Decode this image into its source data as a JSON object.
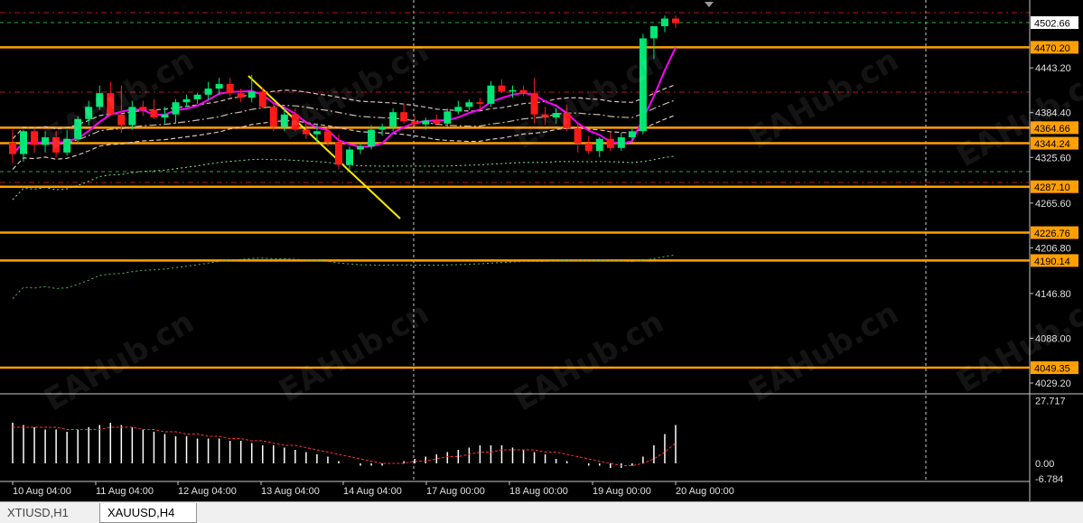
{
  "tabs": [
    {
      "label": "XTIUSD,H1",
      "active": false
    },
    {
      "label": "XAUUSD,H4",
      "active": true
    }
  ],
  "watermark_text": "EAHub.cn",
  "colors": {
    "background": "#000000",
    "bull_candle": "#00e676",
    "bear_candle": "#ff1a1a",
    "level_line": "#ffa000",
    "fast_ma": "#ff00ff",
    "trend_line": "#ffea00",
    "price_tag_bg": "#ffa000",
    "current_price_bg": "#ffffff",
    "osc_hist": "#ffffff",
    "osc_signal": "#ff3030"
  },
  "chart_data": {
    "type": "candlestick",
    "symbol": "XAUUSD",
    "timeframe": "H4",
    "x_tick_labels": [
      "10 Aug 04:00",
      "11 Aug 04:00",
      "12 Aug 04:00",
      "13 Aug 04:00",
      "14 Aug 04:00",
      "17 Aug 00:00",
      "18 Aug 00:00",
      "19 Aug 00:00",
      "20 Aug 00:00"
    ],
    "y_tick_labels": [
      "4443.20",
      "4384.40",
      "4325.60",
      "4265.60",
      "4206.80",
      "4146.80",
      "4088.00",
      "4029.20"
    ],
    "ylim": [
      4015,
      4530
    ],
    "current_price": "4502.66",
    "horizontal_levels": [
      "4470.20",
      "4364.66",
      "4344.24",
      "4287.10",
      "4226.76",
      "4190.14",
      "4049.35"
    ],
    "candles": [
      {
        "o": 4345,
        "h": 4362,
        "l": 4318,
        "c": 4330
      },
      {
        "o": 4330,
        "h": 4362,
        "l": 4320,
        "c": 4360
      },
      {
        "o": 4360,
        "h": 4363,
        "l": 4332,
        "c": 4342
      },
      {
        "o": 4342,
        "h": 4360,
        "l": 4332,
        "c": 4352
      },
      {
        "o": 4352,
        "h": 4360,
        "l": 4326,
        "c": 4332
      },
      {
        "o": 4332,
        "h": 4362,
        "l": 4328,
        "c": 4350
      },
      {
        "o": 4350,
        "h": 4380,
        "l": 4346,
        "c": 4376
      },
      {
        "o": 4376,
        "h": 4400,
        "l": 4368,
        "c": 4392
      },
      {
        "o": 4392,
        "h": 4420,
        "l": 4388,
        "c": 4410
      },
      {
        "o": 4410,
        "h": 4425,
        "l": 4380,
        "c": 4382
      },
      {
        "o": 4382,
        "h": 4420,
        "l": 4358,
        "c": 4368
      },
      {
        "o": 4368,
        "h": 4400,
        "l": 4362,
        "c": 4392
      },
      {
        "o": 4392,
        "h": 4400,
        "l": 4380,
        "c": 4388
      },
      {
        "o": 4388,
        "h": 4402,
        "l": 4376,
        "c": 4378
      },
      {
        "o": 4378,
        "h": 4392,
        "l": 4370,
        "c": 4382
      },
      {
        "o": 4382,
        "h": 4402,
        "l": 4370,
        "c": 4398
      },
      {
        "o": 4398,
        "h": 4408,
        "l": 4392,
        "c": 4402
      },
      {
        "o": 4402,
        "h": 4410,
        "l": 4396,
        "c": 4408
      },
      {
        "o": 4408,
        "h": 4425,
        "l": 4402,
        "c": 4416
      },
      {
        "o": 4416,
        "h": 4430,
        "l": 4408,
        "c": 4422
      },
      {
        "o": 4422,
        "h": 4430,
        "l": 4406,
        "c": 4410
      },
      {
        "o": 4410,
        "h": 4416,
        "l": 4398,
        "c": 4404
      },
      {
        "o": 4404,
        "h": 4434,
        "l": 4398,
        "c": 4412
      },
      {
        "o": 4412,
        "h": 4418,
        "l": 4390,
        "c": 4392
      },
      {
        "o": 4392,
        "h": 4398,
        "l": 4360,
        "c": 4366
      },
      {
        "o": 4366,
        "h": 4390,
        "l": 4360,
        "c": 4382
      },
      {
        "o": 4382,
        "h": 4390,
        "l": 4360,
        "c": 4362
      },
      {
        "o": 4362,
        "h": 4372,
        "l": 4350,
        "c": 4356
      },
      {
        "o": 4356,
        "h": 4370,
        "l": 4345,
        "c": 4360
      },
      {
        "o": 4360,
        "h": 4366,
        "l": 4340,
        "c": 4346
      },
      {
        "o": 4346,
        "h": 4356,
        "l": 4310,
        "c": 4316
      },
      {
        "o": 4316,
        "h": 4340,
        "l": 4310,
        "c": 4336
      },
      {
        "o": 4336,
        "h": 4345,
        "l": 4330,
        "c": 4340
      },
      {
        "o": 4340,
        "h": 4368,
        "l": 4336,
        "c": 4362
      },
      {
        "o": 4362,
        "h": 4370,
        "l": 4354,
        "c": 4366
      },
      {
        "o": 4366,
        "h": 4390,
        "l": 4360,
        "c": 4385
      },
      {
        "o": 4385,
        "h": 4395,
        "l": 4370,
        "c": 4373
      },
      {
        "o": 4373,
        "h": 4380,
        "l": 4366,
        "c": 4369
      },
      {
        "o": 4369,
        "h": 4378,
        "l": 4362,
        "c": 4374
      },
      {
        "o": 4374,
        "h": 4382,
        "l": 4368,
        "c": 4370
      },
      {
        "o": 4370,
        "h": 4390,
        "l": 4366,
        "c": 4386
      },
      {
        "o": 4386,
        "h": 4400,
        "l": 4382,
        "c": 4392
      },
      {
        "o": 4392,
        "h": 4402,
        "l": 4388,
        "c": 4398
      },
      {
        "o": 4398,
        "h": 4404,
        "l": 4388,
        "c": 4396
      },
      {
        "o": 4396,
        "h": 4426,
        "l": 4392,
        "c": 4420
      },
      {
        "o": 4420,
        "h": 4428,
        "l": 4410,
        "c": 4412
      },
      {
        "o": 4412,
        "h": 4420,
        "l": 4404,
        "c": 4414
      },
      {
        "o": 4414,
        "h": 4420,
        "l": 4406,
        "c": 4410
      },
      {
        "o": 4410,
        "h": 4430,
        "l": 4370,
        "c": 4382
      },
      {
        "o": 4382,
        "h": 4392,
        "l": 4368,
        "c": 4378
      },
      {
        "o": 4378,
        "h": 4390,
        "l": 4370,
        "c": 4384
      },
      {
        "o": 4384,
        "h": 4395,
        "l": 4360,
        "c": 4364
      },
      {
        "o": 4364,
        "h": 4370,
        "l": 4332,
        "c": 4344
      },
      {
        "o": 4344,
        "h": 4354,
        "l": 4330,
        "c": 4334
      },
      {
        "o": 4334,
        "h": 4352,
        "l": 4326,
        "c": 4350
      },
      {
        "o": 4350,
        "h": 4360,
        "l": 4334,
        "c": 4338
      },
      {
        "o": 4338,
        "h": 4358,
        "l": 4334,
        "c": 4352
      },
      {
        "o": 4352,
        "h": 4366,
        "l": 4348,
        "c": 4360
      },
      {
        "o": 4360,
        "h": 4488,
        "l": 4356,
        "c": 4482
      },
      {
        "o": 4482,
        "h": 4492,
        "l": 4455,
        "c": 4498
      },
      {
        "o": 4498,
        "h": 4512,
        "l": 4490,
        "c": 4508
      },
      {
        "o": 4508,
        "h": 4512,
        "l": 4496,
        "c": 4502
      }
    ],
    "oscillator": {
      "y_tick_labels": [
        "27.717",
        "0.00",
        "-6.784"
      ],
      "ylim": [
        -8,
        30
      ],
      "histogram": [
        18,
        17,
        16,
        15,
        15,
        14,
        15,
        16,
        17,
        18,
        17,
        16,
        15,
        14,
        13,
        12,
        12,
        11,
        11,
        11,
        10,
        10,
        9,
        8,
        8,
        7,
        6,
        5,
        4,
        3,
        1,
        0,
        -1,
        -1,
        -1,
        0,
        1,
        2,
        3,
        4,
        5,
        6,
        7,
        8,
        8,
        8,
        7,
        6,
        5,
        4,
        2,
        1,
        0,
        -1,
        -1,
        -2,
        -2,
        -1,
        3,
        8,
        13,
        17
      ],
      "signal": [
        16,
        16,
        16,
        16,
        16,
        15,
        15,
        15,
        15,
        16,
        16,
        16,
        15,
        15,
        14,
        14,
        13,
        13,
        12,
        12,
        11,
        11,
        10,
        10,
        9,
        8,
        8,
        7,
        6,
        5,
        4,
        3,
        2,
        1,
        0,
        0,
        0,
        1,
        1,
        2,
        3,
        3,
        4,
        5,
        5,
        6,
        6,
        6,
        6,
        5,
        5,
        4,
        3,
        2,
        1,
        0,
        -1,
        -1,
        0,
        2,
        5,
        9
      ]
    }
  }
}
